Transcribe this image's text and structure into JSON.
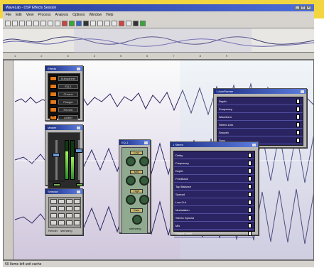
{
  "header": {
    "title": "WaveLab - DSP Effects Session",
    "menus": [
      "File",
      "Edit",
      "View",
      "Process",
      "Analysis",
      "Options",
      "Window",
      "Help"
    ]
  },
  "status": {
    "text": "50 Items left unit cache"
  },
  "effects": {
    "title": "Effects",
    "items": [
      "Autopanner",
      "EQ-1",
      "Chorus",
      "Flanger",
      "Reverb",
      "Limiter"
    ],
    "footer": [
      "Mute",
      "Preset"
    ]
  },
  "master": {
    "title": "Master",
    "footer": [
      "Mute",
      "Preset",
      "steinberg"
    ]
  },
  "selector": {
    "title": "Selector",
    "footer": [
      "Render",
      "steinberg"
    ]
  },
  "eq": {
    "title": "EQ-1",
    "labels": [
      "Low",
      "Mid",
      "High",
      "Gain"
    ],
    "footer": "steinberg"
  },
  "autopanner": {
    "title": "1 AutoPanner",
    "params": [
      "Depth",
      "Frequency",
      "Waveform",
      "Stereo Link",
      "Smooth",
      "Sync"
    ]
  },
  "stereo": {
    "title": "1 Stereo",
    "params": [
      "Delay",
      "Frequency",
      "Depth",
      "Feedback",
      "Tap Balance",
      "Spread",
      "Low Cut",
      "Modulation",
      "Stereo Spread",
      "Mix",
      "Output Level"
    ]
  },
  "colors": {
    "accent": "#2c3fa1",
    "background": "#f3d63f",
    "wave": "#2b2463"
  }
}
